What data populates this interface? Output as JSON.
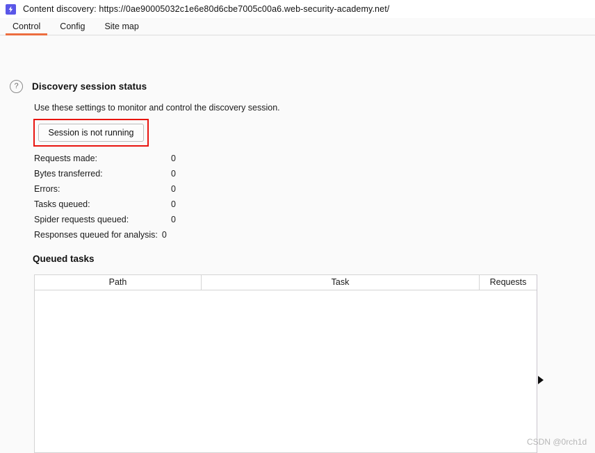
{
  "window": {
    "icon": "lightning-bolt-icon",
    "title": "Content discovery: https://0ae90005032c1e6e80d6cbe7005c00a6.web-security-academy.net/"
  },
  "tabs": [
    {
      "label": "Control",
      "active": true
    },
    {
      "label": "Config",
      "active": false
    },
    {
      "label": "Site map",
      "active": false
    }
  ],
  "session_status": {
    "help_icon": "?",
    "title": "Discovery session status",
    "description": "Use these settings to monitor and control the discovery session.",
    "button_label": "Session is not running",
    "stats": [
      {
        "label": "Requests made:",
        "value": "0"
      },
      {
        "label": "Bytes transferred:",
        "value": "0"
      },
      {
        "label": "Errors:",
        "value": "0"
      },
      {
        "label": "Tasks queued:",
        "value": "0"
      },
      {
        "label": "Spider requests queued:",
        "value": "0"
      },
      {
        "label": "Responses queued for analysis:",
        "value": "0"
      }
    ]
  },
  "queued_tasks": {
    "title": "Queued tasks",
    "columns": [
      "Path",
      "Task",
      "Requests"
    ],
    "rows": []
  },
  "splitter": {
    "arrow_icon": "triangle-right-icon"
  },
  "watermark": {
    "text": "CSDN @0rch1d"
  },
  "colors": {
    "accent": "#ec6d3f",
    "app_icon": "#5a57e8",
    "annotation": "#e8140f",
    "background": "#fafafa",
    "panel": "#ffffff",
    "border": "#d4d4d4"
  }
}
